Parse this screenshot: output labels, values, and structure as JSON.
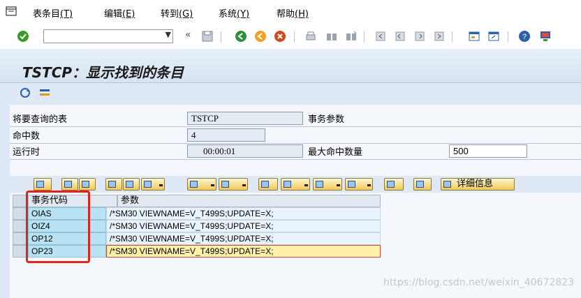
{
  "menubar": {
    "items": [
      {
        "label": "表条目",
        "key": "(T)"
      },
      {
        "label": "编辑",
        "key": "(E)"
      },
      {
        "label": "转到",
        "key": "(G)"
      },
      {
        "label": "系统",
        "key": "(Y)"
      },
      {
        "label": "帮助",
        "key": "(H)"
      }
    ]
  },
  "toolbar": {
    "command_field_value": "",
    "prev_symbol": "«"
  },
  "title": "TSTCP：显示找到的条目",
  "form": {
    "table_label": "将要查询的表",
    "table_value": "TSTCP",
    "table_desc": "事务参数",
    "hits_label": "命中数",
    "hits_value": "4",
    "runtime_label": "运行时",
    "runtime_value": "00:00:01",
    "maxhits_label": "最大命中数量",
    "maxhits_value": "500"
  },
  "alv": {
    "detail_button": "详细信息"
  },
  "grid": {
    "columns": [
      "事务代码",
      "参数"
    ],
    "rows": [
      {
        "code": "OIAS",
        "param": "/*SM30 VIEWNAME=V_T499S;UPDATE=X;"
      },
      {
        "code": "OIZ4",
        "param": "/*SM30 VIEWNAME=V_T499S;UPDATE=X;"
      },
      {
        "code": "OP12",
        "param": "/*SM30 VIEWNAME=V_T499S;UPDATE=X;"
      },
      {
        "code": "OP23",
        "param": "/*SM30 VIEWNAME=V_T499S;UPDATE=X;"
      }
    ]
  },
  "watermark": "https://blog.csdn.net/weixin_40672823",
  "colors": {
    "highlight_box": "#e0241b",
    "selected_row": "#fff2a8"
  }
}
